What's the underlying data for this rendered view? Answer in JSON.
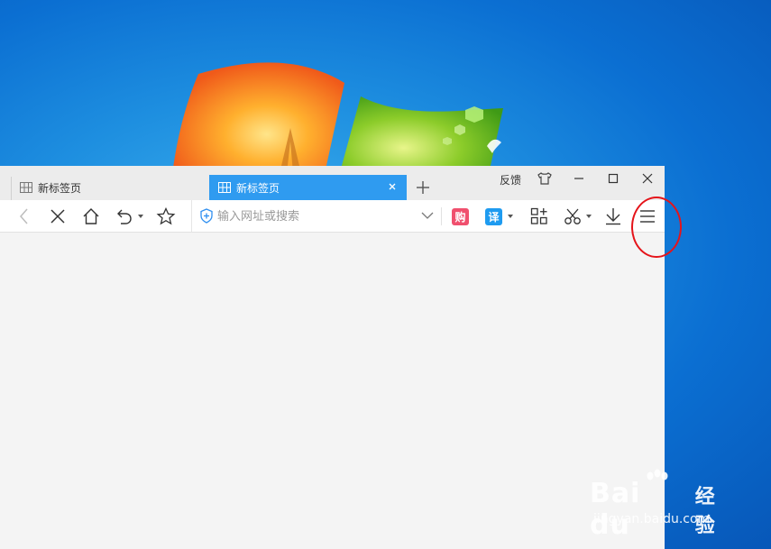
{
  "desktop": {
    "watermark": {
      "brand": "Bai du",
      "brand_cn": "经验",
      "url": "jingyan.baidu.com"
    }
  },
  "tabs": [
    {
      "label": "新标签页",
      "active": false
    },
    {
      "label": "新标签页",
      "active": true
    }
  ],
  "titlebar": {
    "feedback_label": "反馈"
  },
  "address_bar": {
    "value": "",
    "placeholder": "输入网址或搜索"
  },
  "toolbar": {
    "shop_badge": "购",
    "translate_badge": "译"
  },
  "colors": {
    "active_tab": "#2f9bf0",
    "shop_badge": "#f0506e",
    "translate_badge": "#1e9bf0",
    "highlight_ring": "#e5141a"
  },
  "icons": [
    "grid-icon",
    "close-icon",
    "plus-icon",
    "skin-icon",
    "minimize-icon",
    "maximize-icon",
    "back-icon",
    "stop-icon",
    "home-icon",
    "undo-icon",
    "star-icon",
    "shield-icon",
    "chevron-down-icon",
    "apps-icon",
    "scissors-icon",
    "download-icon",
    "menu-icon"
  ]
}
